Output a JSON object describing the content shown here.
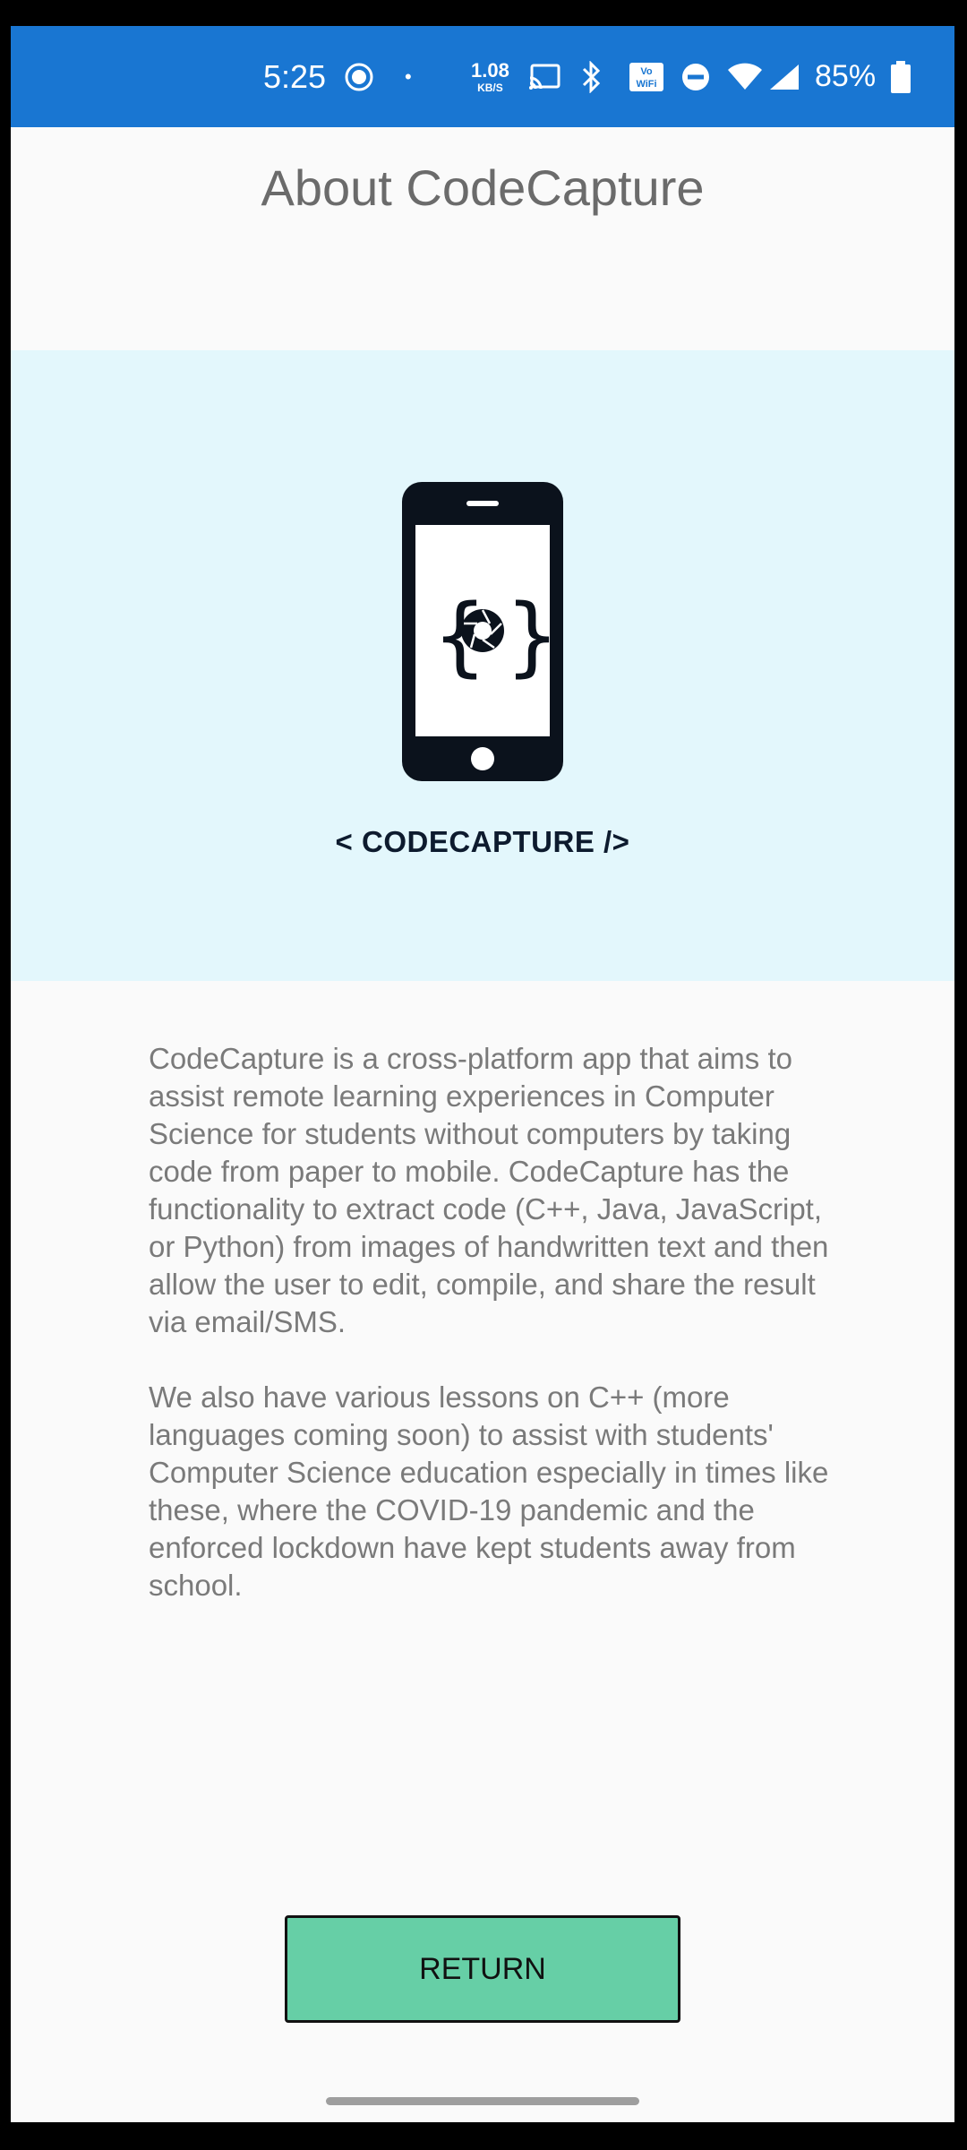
{
  "status_bar": {
    "time": "5:25",
    "dot": "•",
    "net_speed_value": "1.08",
    "net_speed_unit": "KB/S",
    "battery_percent": "85%",
    "icons": [
      "screen-record-icon",
      "cast-icon",
      "bluetooth-icon",
      "volte-wifi-icon",
      "do-not-disturb-icon",
      "wifi-icon",
      "signal-icon",
      "battery-icon"
    ]
  },
  "page": {
    "title": "About CodeCapture"
  },
  "logo": {
    "text": "< CODECAPTURE />"
  },
  "about": {
    "paragraphs": [
      "CodeCapture is a cross-platform app that aims to assist remote learning experiences in Computer Science for students without computers by taking code from paper to mobile. CodeCapture has the functionality to extract code (C++, Java, JavaScript, or Python) from images of handwritten text and then allow the user to edit, compile, and share the result via email/SMS.",
      "We also have various lessons on C++ (more languages coming soon) to assist with students' Computer Science education especially in times like these, where the COVID-19 pandemic and the enforced lockdown have kept students away from school."
    ]
  },
  "actions": {
    "return_label": "RETURN"
  },
  "colors": {
    "status_bar": "#1976d2",
    "logo_panel": "#e3f7fc",
    "return_button": "#66cfa6",
    "background": "#fafafa"
  }
}
